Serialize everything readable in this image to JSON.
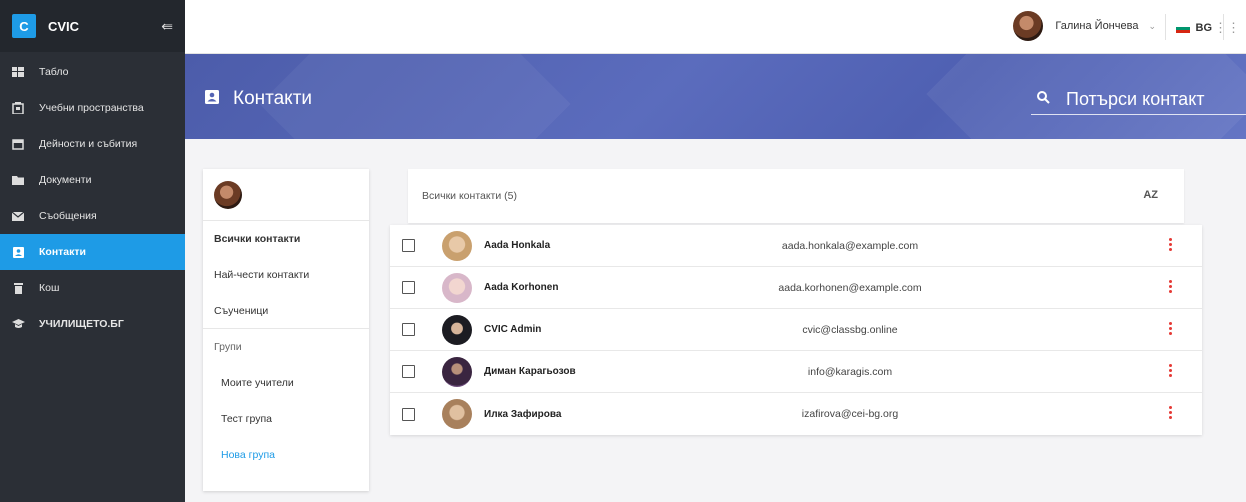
{
  "brand": {
    "logo_letter": "C",
    "name": "CVIC"
  },
  "sidebar": {
    "items": [
      {
        "label": "Табло",
        "icon": "dashboard-icon"
      },
      {
        "label": "Учебни пространства",
        "icon": "building-icon"
      },
      {
        "label": "Дейности и събития",
        "icon": "calendar-icon"
      },
      {
        "label": "Документи",
        "icon": "folder-icon"
      },
      {
        "label": "Съобщения",
        "icon": "mail-icon"
      },
      {
        "label": "Контакти",
        "icon": "contact-icon",
        "active": true
      },
      {
        "label": "Кош",
        "icon": "trash-icon"
      },
      {
        "label": "УЧИЛИЩЕТО.БГ",
        "icon": "graduation-cap-icon"
      }
    ]
  },
  "topbar": {
    "user_name": "Галина Йончева",
    "language": "BG"
  },
  "header": {
    "title": "Контакти",
    "search_placeholder": "Потърси контакт"
  },
  "contacts_menu": {
    "all": "Всички контакти",
    "frequent": "Най-чести контакти",
    "classmates": "Съученици",
    "groups_heading": "Групи",
    "groups": [
      "Моите учители",
      "Тест група"
    ],
    "new_group": "Нова група"
  },
  "list": {
    "heading": "Всички контакти (5)",
    "sort_label": "AZ",
    "rows": [
      {
        "name": "Aada Honkala",
        "email": "aada.honkala@example.com"
      },
      {
        "name": "Aada Korhonen",
        "email": "aada.korhonen@example.com"
      },
      {
        "name": "CVIC Admin",
        "email": "cvic@classbg.online"
      },
      {
        "name": "Диман Карагьозов",
        "email": "info@karagis.com"
      },
      {
        "name": "Илка Зафирова",
        "email": "izafirova@cei-bg.org"
      }
    ]
  },
  "colors": {
    "sidebar_bg": "#2b2f36",
    "accent": "#1e9be6",
    "banner": "#5464b4",
    "kebab": "#e53935"
  }
}
